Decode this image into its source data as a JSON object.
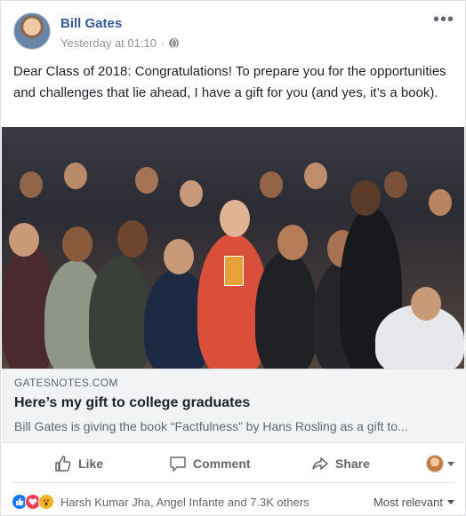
{
  "post": {
    "author": "Bill Gates",
    "timestamp": "Yesterday at 01:10",
    "separator": "·",
    "more_label": "•••",
    "text": "Dear Class of 2018: Congratulations! To prepare you for the opportunities and challenges that lie ahead, I have a gift for you (and yes, it’s a book)."
  },
  "link": {
    "domain": "GATESNOTES.COM",
    "title": "Here’s my gift to college graduates",
    "description": "Bill Gates is giving the book “Factfulness” by Hans Rosling as a gift to..."
  },
  "actions": {
    "like": "Like",
    "comment": "Comment",
    "share": "Share"
  },
  "footer": {
    "reaction_names": "Harsh Kumar Jha, Angel Infante and 7.3K others",
    "sort_label": "Most relevant"
  },
  "icons": {
    "globe": "globe-icon",
    "like": "thumbs-up-icon",
    "comment": "comment-bubble-icon",
    "share": "share-arrow-icon"
  },
  "colors": {
    "author_link": "#365899",
    "meta_text": "#90949c",
    "body_text": "#1d2129",
    "like_reaction": "#1877f2",
    "love_reaction": "#f33e58",
    "wow_reaction": "#f7b125"
  }
}
